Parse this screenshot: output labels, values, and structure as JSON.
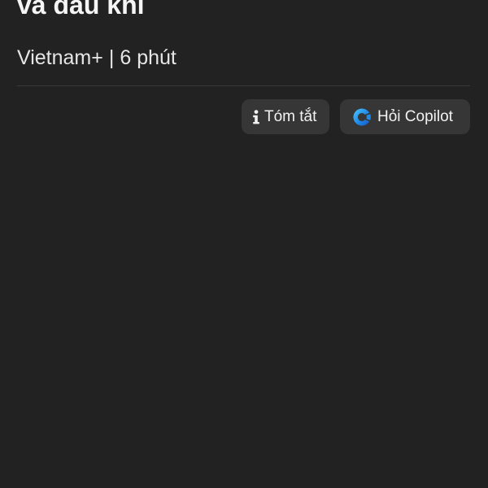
{
  "article": {
    "title": "và dầu khí",
    "source": "Vietnam+",
    "separator": "|",
    "read_time": "6 phút"
  },
  "actions": {
    "summary_label": "Tóm tắt",
    "summary_icon": "info-icon",
    "copilot_label": "Hỏi Copilot",
    "copilot_icon": "copilot-icon"
  },
  "colors": {
    "background": "#222222",
    "button_background": "#363636",
    "text": "#f2f2f2",
    "copilot_blue": "#1f8ae8"
  }
}
